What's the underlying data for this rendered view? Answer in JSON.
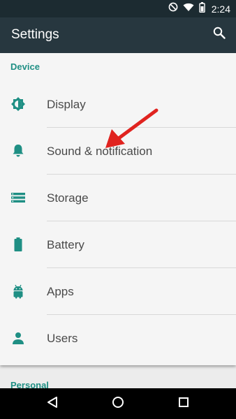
{
  "status_bar": {
    "time": "2:24",
    "icons": [
      "do-not-disturb-icon",
      "wifi-icon",
      "battery-icon"
    ]
  },
  "app_bar": {
    "title": "Settings",
    "search_icon": "search-icon"
  },
  "sections": [
    {
      "header": "Device",
      "items": [
        {
          "label": "Display",
          "icon": "brightness-icon"
        },
        {
          "label": "Sound & notification",
          "icon": "bell-icon"
        },
        {
          "label": "Storage",
          "icon": "storage-icon"
        },
        {
          "label": "Battery",
          "icon": "battery-icon"
        },
        {
          "label": "Apps",
          "icon": "android-icon"
        },
        {
          "label": "Users",
          "icon": "person-icon"
        }
      ]
    },
    {
      "header": "Personal"
    }
  ],
  "nav_bar": {
    "back_icon": "back-triangle-icon",
    "home_icon": "home-circle-icon",
    "recents_icon": "recents-square-icon"
  },
  "colors": {
    "accent": "#1f8f84",
    "status_bar": "#1c2b31",
    "app_bar": "#27373f",
    "annotation_arrow": "#e0231f"
  }
}
